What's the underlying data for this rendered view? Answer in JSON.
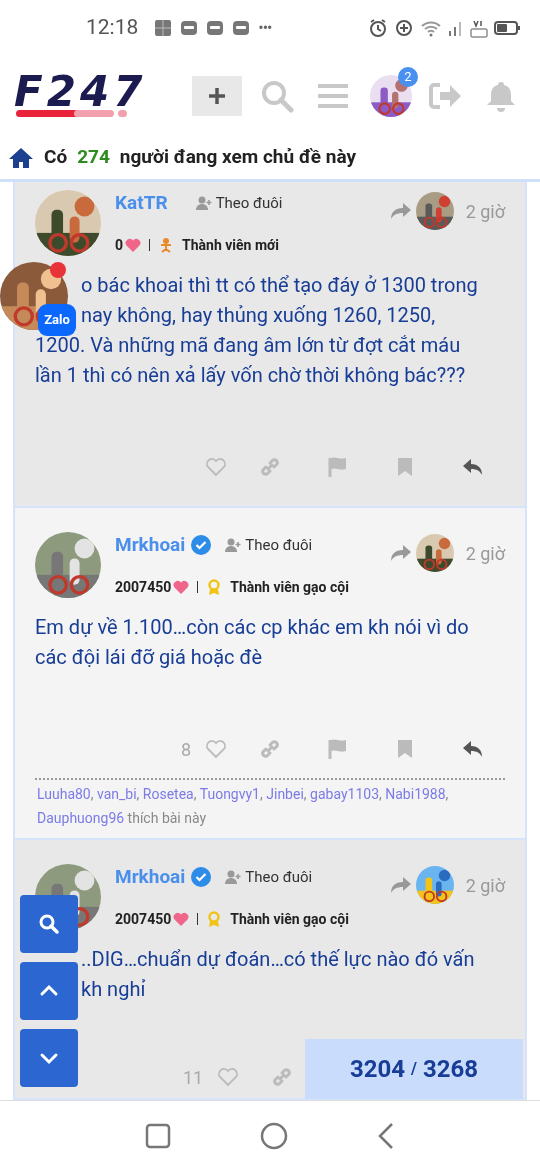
{
  "status_bar": {
    "time": "12:18",
    "notification_more": "•••"
  },
  "header": {
    "logo": "F247",
    "notification_count": "2"
  },
  "viewers": {
    "prefix": "Có",
    "count": "274",
    "suffix": "người đang xem chủ đề này"
  },
  "posts": [
    {
      "author": "KatTR",
      "verified": false,
      "follow_label": "Theo đuôi",
      "time": "2 giờ",
      "likes_received": "0",
      "kind": "new",
      "rank": "Thành viên mới",
      "body_lines": [
        {
          "text": "o bác khoai thì tt có thể tạo đáy ở 1300 trong",
          "indented": true
        },
        {
          "text": "nay không, hay thủng xuống 1260, 1250,",
          "indented": true
        },
        {
          "text": "1200. Và những mã đang âm lớn từ đợt cắt máu"
        },
        {
          "text": "lần 1 thì có nên xả lấy vốn chờ thời không bác???"
        }
      ]
    },
    {
      "author": "Mrkhoai",
      "verified": true,
      "follow_label": "Theo đuôi",
      "time": "2 giờ",
      "likes_received": "2007450",
      "kind": "veteran",
      "rank": "Thành viên gạo cội",
      "body_lines": [
        {
          "text": "Em dự về 1.100…còn các cp khác em kh nói vì do"
        },
        {
          "text": "các đội lái đỡ giá hoặc đè"
        }
      ],
      "like_count": "8",
      "liked_by": [
        "Luuha80",
        "van_bi",
        "Rosetea",
        "Tuongvy1",
        "Jinbei",
        "gabay1103",
        "Nabi1988",
        "Dauphuong96"
      ],
      "liked_separator": ",",
      "liked_suffix": "thích bài này"
    },
    {
      "author": "Mrkhoai",
      "verified": true,
      "follow_label": "Theo đuôi",
      "time": "2 giờ",
      "likes_received": "2007450",
      "kind": "veteran",
      "rank": "Thành viên gạo cội",
      "body_lines": [
        {
          "text": "..DIG…chuẩn dự đoán…có thế lực nào đó vấn",
          "indented": true
        },
        {
          "text": "kh nghỉ",
          "indented": true
        }
      ],
      "like_count": "11"
    }
  ],
  "chat_bubble": {
    "label": "Zalo"
  },
  "counter": {
    "current": "3204",
    "separator": "/",
    "total": "3268"
  }
}
